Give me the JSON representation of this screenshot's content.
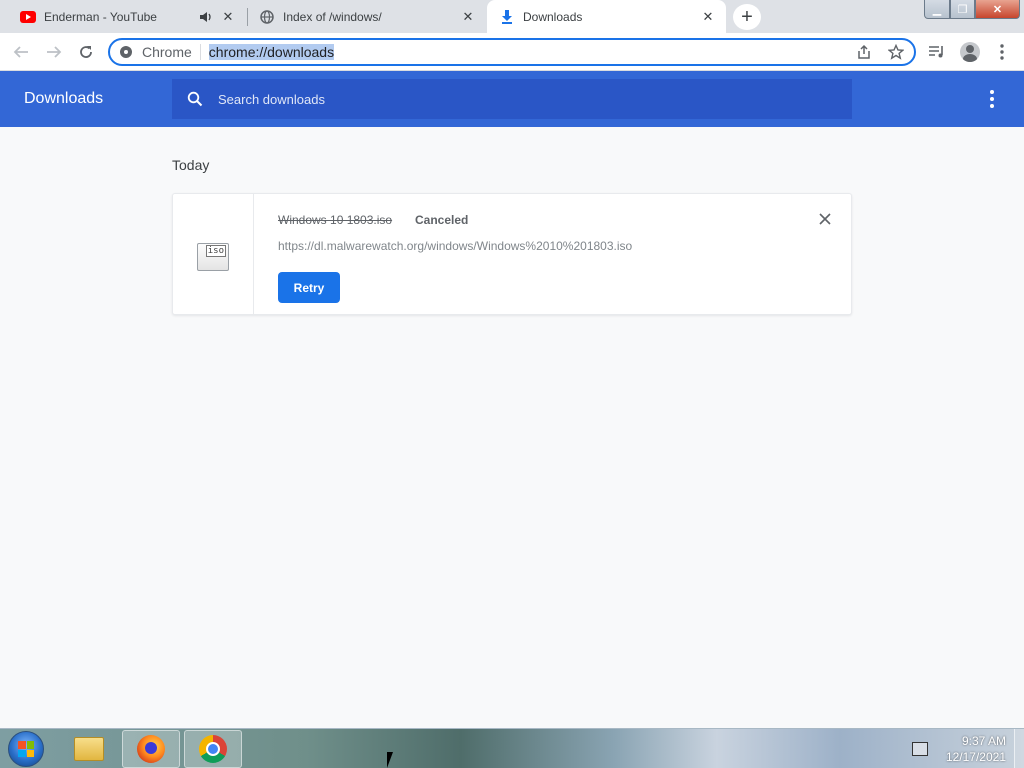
{
  "tabs": [
    {
      "title": "Enderman - YouTube",
      "icon": "youtube-icon",
      "audio": true
    },
    {
      "title": "Index of /windows/",
      "icon": "globe-icon"
    },
    {
      "title": "Downloads",
      "icon": "download-icon",
      "active": true
    }
  ],
  "omnibox": {
    "chip_label": "Chrome",
    "url": "chrome://downloads"
  },
  "downloads": {
    "page_title": "Downloads",
    "search_placeholder": "Search downloads",
    "section_label": "Today",
    "item": {
      "filename": "Windows 10 1803.iso",
      "status": "Canceled",
      "url": "https://dl.malwarewatch.org/windows/Windows%2010%201803.iso",
      "action_label": "Retry",
      "file_ext": "iso"
    }
  },
  "taskbar": {
    "time": "9:37 AM",
    "date": "12/17/2021",
    "apps": [
      "windows-explorer-icon",
      "firefox-icon",
      "chrome-icon"
    ]
  },
  "colors": {
    "header_blue": "#3367d6",
    "search_blue": "#2a56c6",
    "retry_blue": "#1a73e8",
    "youtube_red": "#ff0000"
  }
}
